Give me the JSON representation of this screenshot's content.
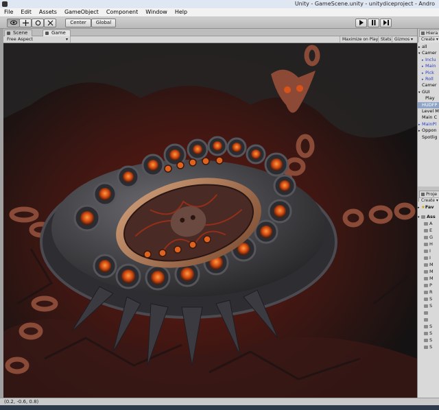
{
  "window": {
    "title": "Unity - GameScene.unity - unitydiceproject - Andro"
  },
  "menu": [
    "File",
    "Edit",
    "Assets",
    "GameObject",
    "Component",
    "Window",
    "Help"
  ],
  "toolbar": {
    "tools": [
      "hand-tool",
      "move-tool",
      "rotate-tool",
      "scale-tool"
    ],
    "pivot_label": "Center",
    "space_label": "Global",
    "play_controls": [
      "play",
      "pause",
      "step"
    ]
  },
  "tabs": {
    "scene": "Scene",
    "game": "Game"
  },
  "game_bar": {
    "aspect": "Free Aspect",
    "maximize": "Maximize on Play",
    "stats": "Stats",
    "gizmos": "Gizmos"
  },
  "hierarchy": {
    "tab": "Hiera",
    "create": "Create",
    "rows": [
      {
        "label": "all",
        "indent": 0,
        "arrow": "▸"
      },
      {
        "label": "Camer",
        "indent": 0,
        "arrow": "▾"
      },
      {
        "label": "Inclu",
        "indent": 1,
        "arrow": "▸",
        "blue": true
      },
      {
        "label": "Main",
        "indent": 1,
        "arrow": "▸",
        "blue": true
      },
      {
        "label": "Pick",
        "indent": 1,
        "arrow": "▸",
        "blue": true
      },
      {
        "label": "Roll",
        "indent": 1,
        "arrow": "▸",
        "blue": true
      },
      {
        "label": "Camer",
        "indent": 0,
        "arrow": ""
      },
      {
        "label": "GUI",
        "indent": 0,
        "arrow": "▾"
      },
      {
        "label": "Play",
        "indent": 1,
        "arrow": ""
      },
      {
        "label": "HUDFP",
        "indent": 0,
        "arrow": "",
        "selected": true
      },
      {
        "label": "Level M",
        "indent": 0,
        "arrow": ""
      },
      {
        "label": "Main C",
        "indent": 0,
        "arrow": ""
      },
      {
        "label": "MainPl",
        "indent": 0,
        "arrow": "▸",
        "blue": true
      },
      {
        "label": "Oppon",
        "indent": 0,
        "arrow": "▸"
      },
      {
        "label": "Spotlig",
        "indent": 0,
        "arrow": ""
      }
    ]
  },
  "project": {
    "tab": "Proje",
    "create": "Create",
    "favorites": "Fav",
    "assets": "Ass",
    "rows": [
      "A",
      "E",
      "G",
      "H",
      "I",
      "I",
      "M",
      "M",
      "M",
      "P",
      "R",
      "S",
      "S",
      "",
      "",
      "S",
      "S",
      "S",
      "S"
    ]
  },
  "status": {
    "message": "(0.2, -0.6, 0.8)"
  },
  "colors": {
    "accent_glow": "#e0621c",
    "stone": "#3a3a3e",
    "rim": "#b27a52",
    "lava": "#7a1a10"
  }
}
